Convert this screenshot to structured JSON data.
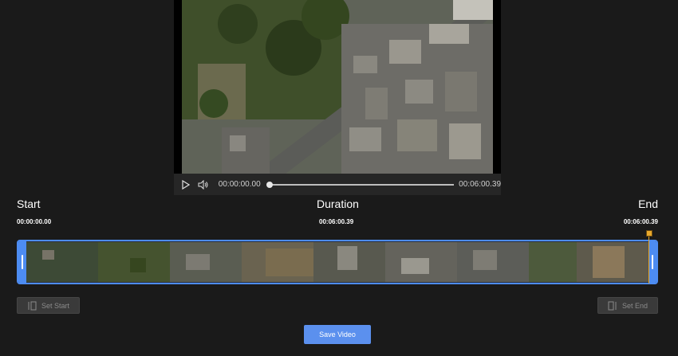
{
  "player": {
    "current_time": "00:00:00.00",
    "total_time": "00:06:00.39",
    "play_icon": "play-icon",
    "volume_icon": "volume-icon"
  },
  "trim": {
    "start_label": "Start",
    "duration_label": "Duration",
    "end_label": "End",
    "start_value": "00:00:00.00",
    "duration_value": "00:06:00.39",
    "end_value": "00:06:00.39"
  },
  "actions": {
    "set_start_label": "Set Start",
    "set_end_label": "Set End",
    "save_label": "Save Video"
  },
  "colors": {
    "accent": "#4d8cf2",
    "save_button": "#5b90ee",
    "end_marker": "#e8a82c",
    "background": "#1a1a1a"
  }
}
